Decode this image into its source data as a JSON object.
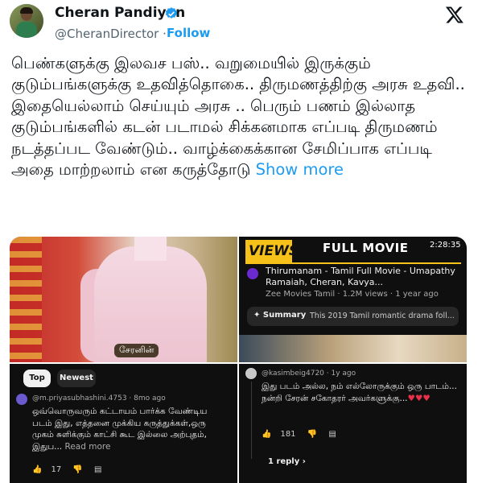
{
  "author": {
    "name": "Cheran Pandiyan",
    "handle": "@CheranDirector",
    "separator": "·",
    "follow_label": "Follow",
    "verified_icon": "verified-badge-icon",
    "accent": "#1d9bf0"
  },
  "tweet": {
    "text": "பெண்களுக்கு இலவச பஸ்.. வறுமையில் இருக்கும் குடும்பங்களுக்கு உதவித்தொகை.. திருமணத்திற்கு அரசு உதவி.. இதையெல்லாம் செய்யும் அரசு .. பெரும் பணம் இல்லாத குடும்பங்களில் கடன் படாமல் சிக்கனமாக எப்படி திருமணம் நடத்தப்பட வேண்டும்.. வாழ்க்கைக்கான சேமிப்பாக எப்படி அதை மாற்றலாம் என கருத்தோடு",
    "show_more": "Show more"
  },
  "media": {
    "image1": {
      "caption": "சேரனின்"
    },
    "image2": {
      "views_badge": "VIEWS",
      "banner": "FULL MOVIE",
      "duration": "2:28:35",
      "video_title": "Thirumanam - Tamil Full Movie - Umapathy Ramaiah, Cheran, Kavya...",
      "meta": "Zee Movies Tamil · 1.2M views · 1 year ago",
      "summary_label": "Summary",
      "summary_text": "This 2019 Tamil romantic drama foll..."
    },
    "image3": {
      "tab_top": "Top",
      "tab_newest": "Newest",
      "comment": {
        "user": "@m.priyasubhashini.4753 · 8mo ago",
        "text": "ஒவ்வொருவரும் கட்டாயம் பார்க்க வேண்டிய படம் இது, எத்தனை முக்கிய கருத்துக்கள்,ஒரு முகம் சுளிக்கும் காட்சி கூட இல்லை அற்புதம், இதுப...",
        "read_more": "Read more",
        "likes": "17"
      }
    },
    "image4": {
      "comment": {
        "user": "@kasimbeig4720 · 1y ago",
        "text": "இது படம் அல்ல, நம் எல்லோருக்கும் ஒரு பாடம்... நன்றி சேரன் சகோதரர் அவர்களுக்கு...",
        "hearts": "♥♥♥",
        "likes": "181"
      },
      "replies": "1 reply"
    }
  }
}
